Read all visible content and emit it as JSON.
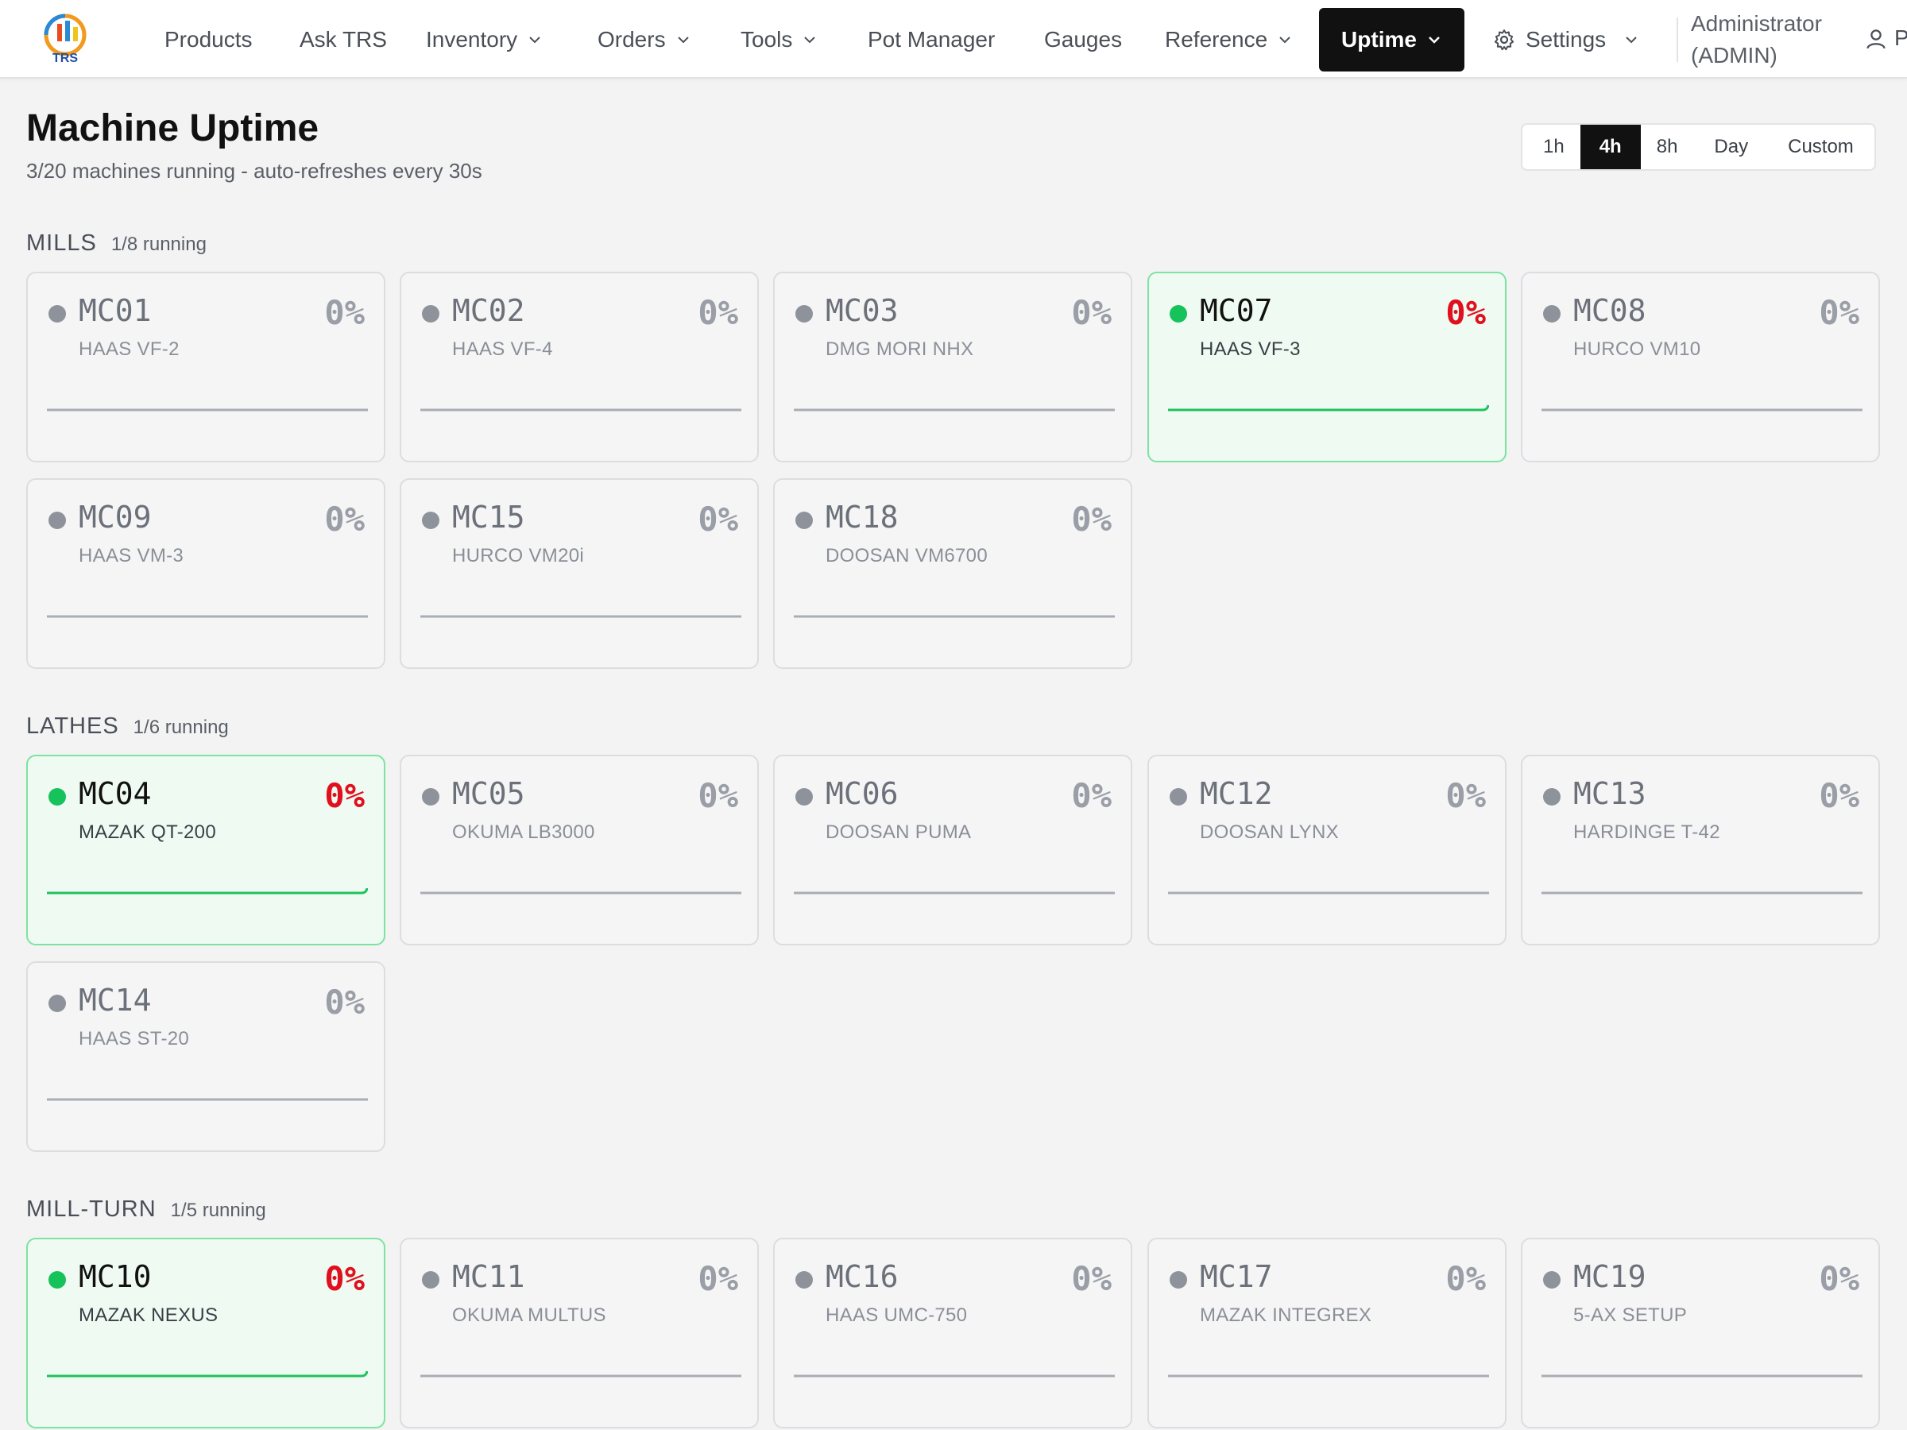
{
  "nav": {
    "logo_text": "TRS",
    "items": [
      {
        "label": "Products",
        "dropdown": false
      },
      {
        "label": "Ask TRS",
        "dropdown": false
      },
      {
        "label": "Inventory",
        "dropdown": true
      },
      {
        "label": "Orders",
        "dropdown": true
      },
      {
        "label": "Tools",
        "dropdown": true
      },
      {
        "label": "Pot Manager",
        "dropdown": false
      },
      {
        "label": "Gauges",
        "dropdown": false
      },
      {
        "label": "Reference",
        "dropdown": true
      },
      {
        "label": "Uptime",
        "dropdown": true,
        "active": true
      }
    ],
    "settings_label": "Settings",
    "user_name": "Administrator",
    "user_role": "(ADMIN)",
    "truncated_label": "P"
  },
  "page": {
    "title": "Machine Uptime",
    "subtitle": "3/20 machines running - auto-refreshes every 30s"
  },
  "time_range": {
    "options": [
      "1h",
      "4h",
      "8h",
      "Day",
      "Custom"
    ],
    "selected": "4h"
  },
  "sections": [
    {
      "name": "MILLS",
      "count": "1/8 running",
      "machines": [
        {
          "id": "MC01",
          "model": "HAAS VF-2",
          "uptime": "0%",
          "running": false
        },
        {
          "id": "MC02",
          "model": "HAAS VF-4",
          "uptime": "0%",
          "running": false
        },
        {
          "id": "MC03",
          "model": "DMG MORI NHX",
          "uptime": "0%",
          "running": false
        },
        {
          "id": "MC07",
          "model": "HAAS VF-3",
          "uptime": "0%",
          "running": true
        },
        {
          "id": "MC08",
          "model": "HURCO VM10",
          "uptime": "0%",
          "running": false
        },
        {
          "id": "MC09",
          "model": "HAAS VM-3",
          "uptime": "0%",
          "running": false
        },
        {
          "id": "MC15",
          "model": "HURCO VM20i",
          "uptime": "0%",
          "running": false
        },
        {
          "id": "MC18",
          "model": "DOOSAN VM6700",
          "uptime": "0%",
          "running": false
        }
      ]
    },
    {
      "name": "LATHES",
      "count": "1/6 running",
      "machines": [
        {
          "id": "MC04",
          "model": "MAZAK QT-200",
          "uptime": "0%",
          "running": true
        },
        {
          "id": "MC05",
          "model": "OKUMA LB3000",
          "uptime": "0%",
          "running": false
        },
        {
          "id": "MC06",
          "model": "DOOSAN PUMA",
          "uptime": "0%",
          "running": false
        },
        {
          "id": "MC12",
          "model": "DOOSAN LYNX",
          "uptime": "0%",
          "running": false
        },
        {
          "id": "MC13",
          "model": "HARDINGE T-42",
          "uptime": "0%",
          "running": false
        },
        {
          "id": "MC14",
          "model": "HAAS ST-20",
          "uptime": "0%",
          "running": false
        }
      ]
    },
    {
      "name": "MILL-TURN",
      "count": "1/5 running",
      "machines": [
        {
          "id": "MC10",
          "model": "MAZAK NEXUS",
          "uptime": "0%",
          "running": true
        },
        {
          "id": "MC11",
          "model": "OKUMA MULTUS",
          "uptime": "0%",
          "running": false
        },
        {
          "id": "MC16",
          "model": "HAAS UMC-750",
          "uptime": "0%",
          "running": false
        },
        {
          "id": "MC17",
          "model": "MAZAK INTEGREX",
          "uptime": "0%",
          "running": false
        },
        {
          "id": "MC19",
          "model": "5-AX SETUP",
          "uptime": "0%",
          "running": false
        }
      ]
    }
  ],
  "colors": {
    "running_dot": "#16c25a",
    "idle_dot": "#8e939b",
    "running_pct": "#e0101e",
    "active_tab": "#111111"
  }
}
